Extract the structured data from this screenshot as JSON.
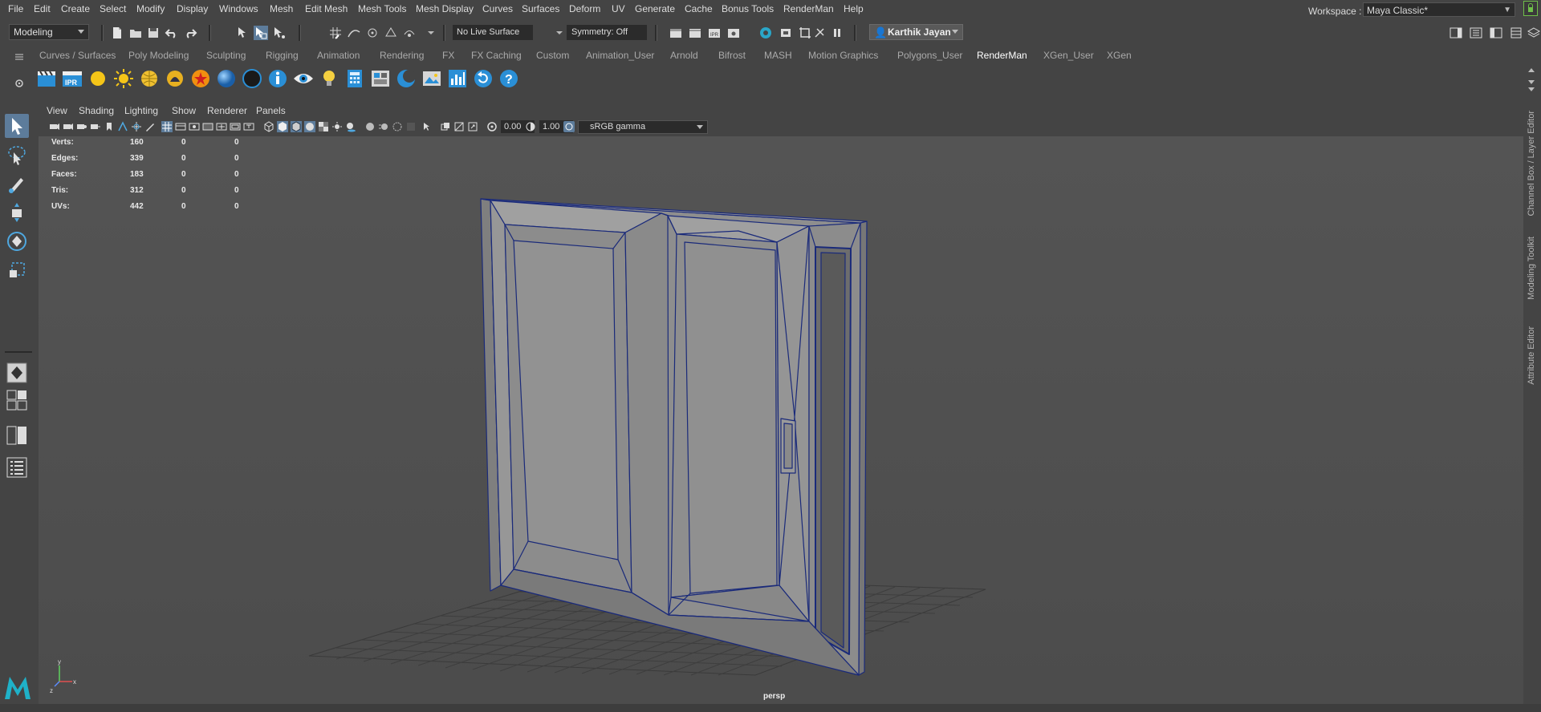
{
  "menu": [
    "File",
    "Edit",
    "Create",
    "Select",
    "Modify",
    "Display",
    "Windows",
    "Mesh",
    "Edit Mesh",
    "Mesh Tools",
    "Mesh Display",
    "Curves",
    "Surfaces",
    "Deform",
    "UV",
    "Generate",
    "Cache",
    "Bonus Tools",
    "RenderMan",
    "Help"
  ],
  "workspace": {
    "label": "Workspace :",
    "value": "Maya Classic*"
  },
  "status_line": {
    "mode": "Modeling",
    "live_surface": "No Live Surface",
    "symmetry": "Symmetry: Off",
    "user": "Karthik Jayan"
  },
  "shelf": {
    "tabs": [
      "Curves / Surfaces",
      "Poly Modeling",
      "Sculpting",
      "Rigging",
      "Animation",
      "Rendering",
      "FX",
      "FX Caching",
      "Custom",
      "Animation_User",
      "Arnold",
      "Bifrost",
      "MASH",
      "Motion Graphics",
      "Polygons_User",
      "RenderMan",
      "XGen_User",
      "XGen"
    ],
    "active_tab": "RenderMan",
    "ipr_label": "IPR"
  },
  "panel": {
    "menus": [
      "View",
      "Shading",
      "Lighting",
      "Show",
      "Renderer",
      "Panels"
    ],
    "exposure": "0.00",
    "gamma": "1.00",
    "color_space": "sRGB gamma",
    "camera": "persp"
  },
  "hud": {
    "rows": [
      {
        "label": "Verts:",
        "a": "160",
        "b": "0",
        "c": "0"
      },
      {
        "label": "Edges:",
        "a": "339",
        "b": "0",
        "c": "0"
      },
      {
        "label": "Faces:",
        "a": "183",
        "b": "0",
        "c": "0"
      },
      {
        "label": "Tris:",
        "a": "312",
        "b": "0",
        "c": "0"
      },
      {
        "label": "UVs:",
        "a": "442",
        "b": "0",
        "c": "0"
      }
    ]
  },
  "side_tabs": [
    "Channel Box / Layer Editor",
    "Modeling Toolkit",
    "Attribute Editor"
  ],
  "colors": {
    "accent": "#5d7c9b",
    "wireframe": "#1a2a7a",
    "viewport_bg": "#535353",
    "lock": "#6fbf4a"
  }
}
